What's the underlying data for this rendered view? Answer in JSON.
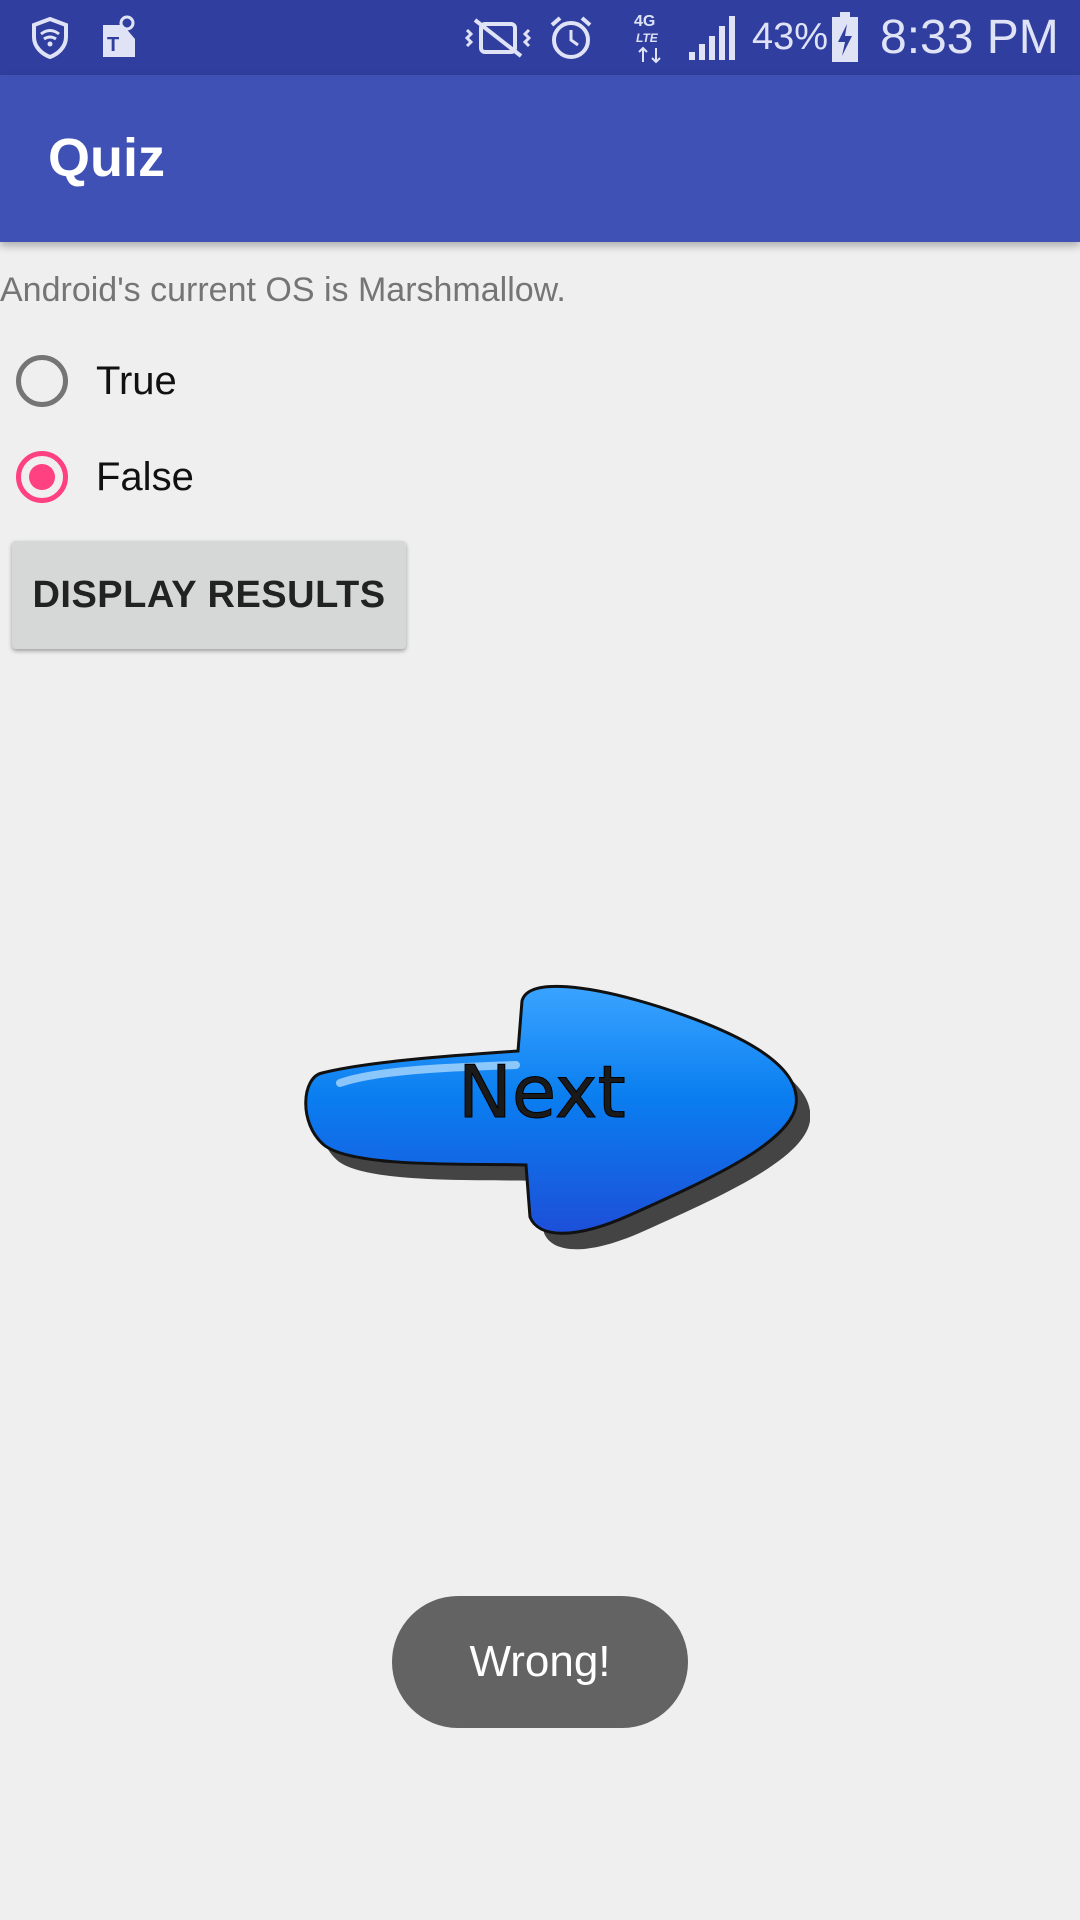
{
  "status_bar": {
    "battery_percent": "43%",
    "time": "8:33 PM",
    "icons": [
      "shield-wifi-icon",
      "tmobile-icon",
      "vibrate-icon",
      "alarm-icon",
      "lte-4g-icon",
      "signal-icon",
      "battery-charging-icon"
    ]
  },
  "app_bar": {
    "title": "Quiz"
  },
  "question": {
    "text": "Android's current OS is Marshmallow."
  },
  "options": [
    {
      "label": "True",
      "checked": false
    },
    {
      "label": "False",
      "checked": true
    }
  ],
  "buttons": {
    "display_results": "DISPLAY RESULTS"
  },
  "next_image": {
    "text": "Next",
    "icon": "next-arrow-icon"
  },
  "toast": {
    "text": "Wrong!"
  },
  "colors": {
    "status_bar": "#303f9f",
    "app_bar": "#3f51b5",
    "accent": "#ff4081",
    "background": "#efefef",
    "arrow_blue": "#0a7ef0"
  }
}
